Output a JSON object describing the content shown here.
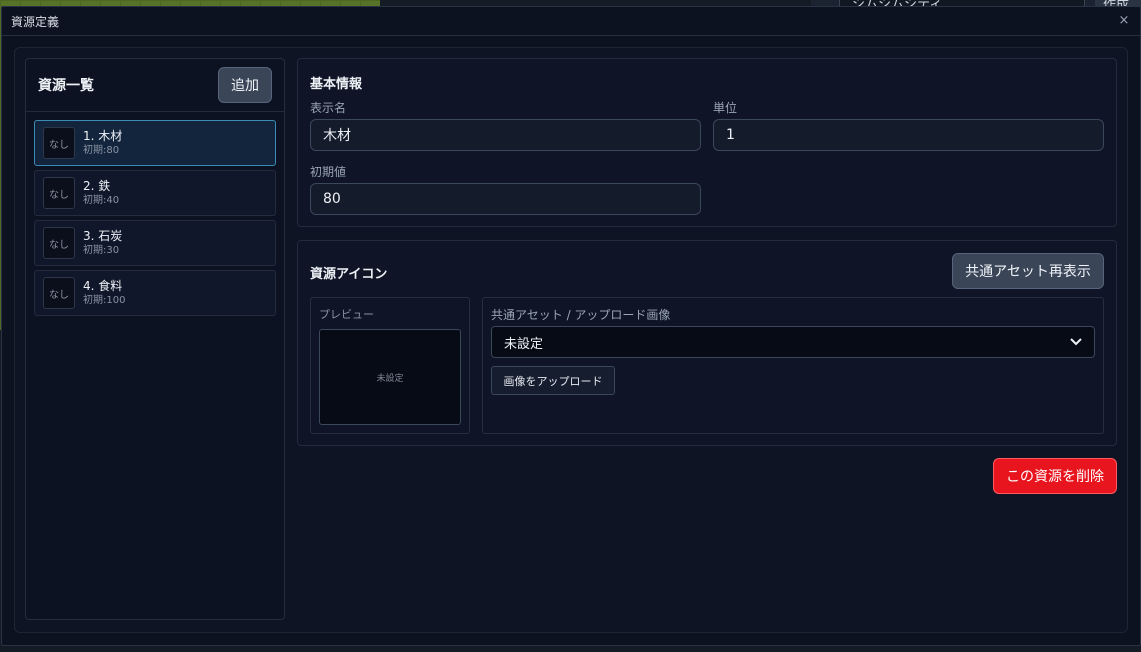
{
  "background": {
    "select_value": "シムシムシティ",
    "button_label": "作成"
  },
  "modal": {
    "title": "資源定義",
    "close_glyph": "×"
  },
  "resource_list": {
    "title": "資源一覧",
    "add_label": "追加",
    "items": [
      {
        "thumb": "なし",
        "name": "1. 木材",
        "initial": "初期:80",
        "selected": true
      },
      {
        "thumb": "なし",
        "name": "2. 鉄",
        "initial": "初期:40",
        "selected": false
      },
      {
        "thumb": "なし",
        "name": "3. 石炭",
        "initial": "初期:30",
        "selected": false
      },
      {
        "thumb": "なし",
        "name": "4. 食料",
        "initial": "初期:100",
        "selected": false
      }
    ]
  },
  "basic_info": {
    "title": "基本情報",
    "display_name_label": "表示名",
    "display_name_value": "木材",
    "unit_label": "単位",
    "unit_value": "1",
    "initial_label": "初期値",
    "initial_value": "80"
  },
  "resource_icon": {
    "title": "資源アイコン",
    "reshow_label": "共通アセット再表示",
    "preview_label": "プレビュー",
    "preview_empty": "未設定",
    "asset_label": "共通アセット / アップロード画像",
    "asset_selected": "未設定",
    "upload_label": "画像をアップロード"
  },
  "actions": {
    "delete_label": "この資源を削除"
  },
  "colors": {
    "accent_selected": "#3a8bb5",
    "danger": "#e8141e",
    "modal_bg": "#0d1220"
  }
}
